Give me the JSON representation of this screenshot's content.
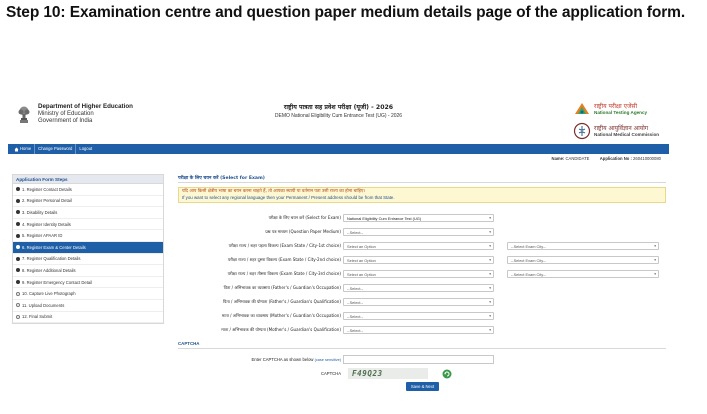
{
  "slide_title": "Step 10: Examination centre and question paper medium details page of the application form.",
  "header": {
    "dept_line1": "Department of Higher Education",
    "dept_line2": "Ministry of Education",
    "dept_line3": "Government of India",
    "exam_title_hi": "राष्ट्रीय पात्रता सह प्रवेश परीक्षा (यूजी) - 2026",
    "exam_title_en": "DEMO National Eligibility Cum Entrance Test (UG) - 2026",
    "nta_hi": "राष्ट्रीय परीक्षा एजेंसी",
    "nta_en": "National Testing Agency",
    "nmc_hi": "राष्ट्रीय आयुर्विज्ञान आयोग",
    "nmc_en": "National Medical Commission"
  },
  "nav": {
    "home": "Home",
    "change_password": "Change Password",
    "logout": "Logout"
  },
  "namebar": {
    "name_label": "Name:",
    "name_value": "CANDIDATE",
    "app_label": "Application No :",
    "app_value": "260410000080"
  },
  "sidebar": {
    "title": "Application Form Steps",
    "steps": [
      {
        "label": "1. Register Contact Details",
        "state": "done"
      },
      {
        "label": "2. Register Personal Detail",
        "state": "done"
      },
      {
        "label": "3. Disability Details",
        "state": "done"
      },
      {
        "label": "4. Register Identity Details",
        "state": "done"
      },
      {
        "label": "5. Register APAAR ID",
        "state": "done"
      },
      {
        "label": "6. Register Exam & Center Details",
        "state": "active"
      },
      {
        "label": "7. Register Qualification Details",
        "state": "done"
      },
      {
        "label": "8. Register Additional Details",
        "state": "done"
      },
      {
        "label": "9. Register Emergency Contact Detail",
        "state": "done"
      },
      {
        "label": "10. Capture Live Photograph",
        "state": "todo"
      },
      {
        "label": "11. Upload Documents",
        "state": "todo"
      },
      {
        "label": "12. Final Submit",
        "state": "todo"
      }
    ]
  },
  "main": {
    "section_title": "परीक्षा के लिए चयन करें (Select for Exam)",
    "notice_hi": "यदि आप किसी क्षेत्रीय भाषा का चयन करना चाहते हैं, तो आपका स्थायी या वर्तमान पता उसी राज्य का होना चाहिए।",
    "notice_en": "If you want to select any regional language then your Permanent / Present address should be from that State.",
    "rows": [
      {
        "label": "परीक्षा के लिए चयन करें (Select for Exam)",
        "value1": "National Eligibility Cum Entrance Test (UG)",
        "value2": ""
      },
      {
        "label": "प्रश्न पत्र माध्यम (Question Paper Medium)",
        "value1": "--Select--",
        "value2": ""
      },
      {
        "label": "परीक्षा राज्य / शहर पहला विकल्प (Exam State / City-1st choice)",
        "value1": "Select an Option",
        "value2": "--Select Exam City--"
      },
      {
        "label": "परीक्षा राज्य / शहर दूसरा विकल्प (Exam State / City-2nd choice)",
        "value1": "Select an Option",
        "value2": "--Select Exam City--"
      },
      {
        "label": "परीक्षा राज्य / शहर तीसरा विकल्प (Exam State / City-3rd choice)",
        "value1": "Select an Option",
        "value2": "--Select Exam City--"
      },
      {
        "label": "पिता / अभिभावक का व्यवसाय (Father's / Guardian's Occupation)",
        "value1": "--Select--",
        "value2": ""
      },
      {
        "label": "पिता / अभिभावक की योग्यता (Father's / Guardian's Qualification)",
        "value1": "--Select--",
        "value2": ""
      },
      {
        "label": "माता / अभिभावक का व्यवसाय (Mother's / Guardian's Occupation)",
        "value1": "--Select--",
        "value2": ""
      },
      {
        "label": "माता / अभिभावक की योग्यता (Mother's / Guardian's Qualification)",
        "value1": "--Select--",
        "value2": ""
      }
    ],
    "captcha_title": "CAPTCHA",
    "captcha_enter_label": "Enter CAPTCHA as shown below",
    "captcha_case_note": "(case sensitive)",
    "captcha_label": "CAPTCHA",
    "captcha_code": "F49Q23",
    "save_button": "Save & Next"
  },
  "colors": {
    "nav_blue": "#1f5fa8",
    "notice_bg": "#fdf7d2",
    "heading_blue": "#1f4f8f"
  }
}
